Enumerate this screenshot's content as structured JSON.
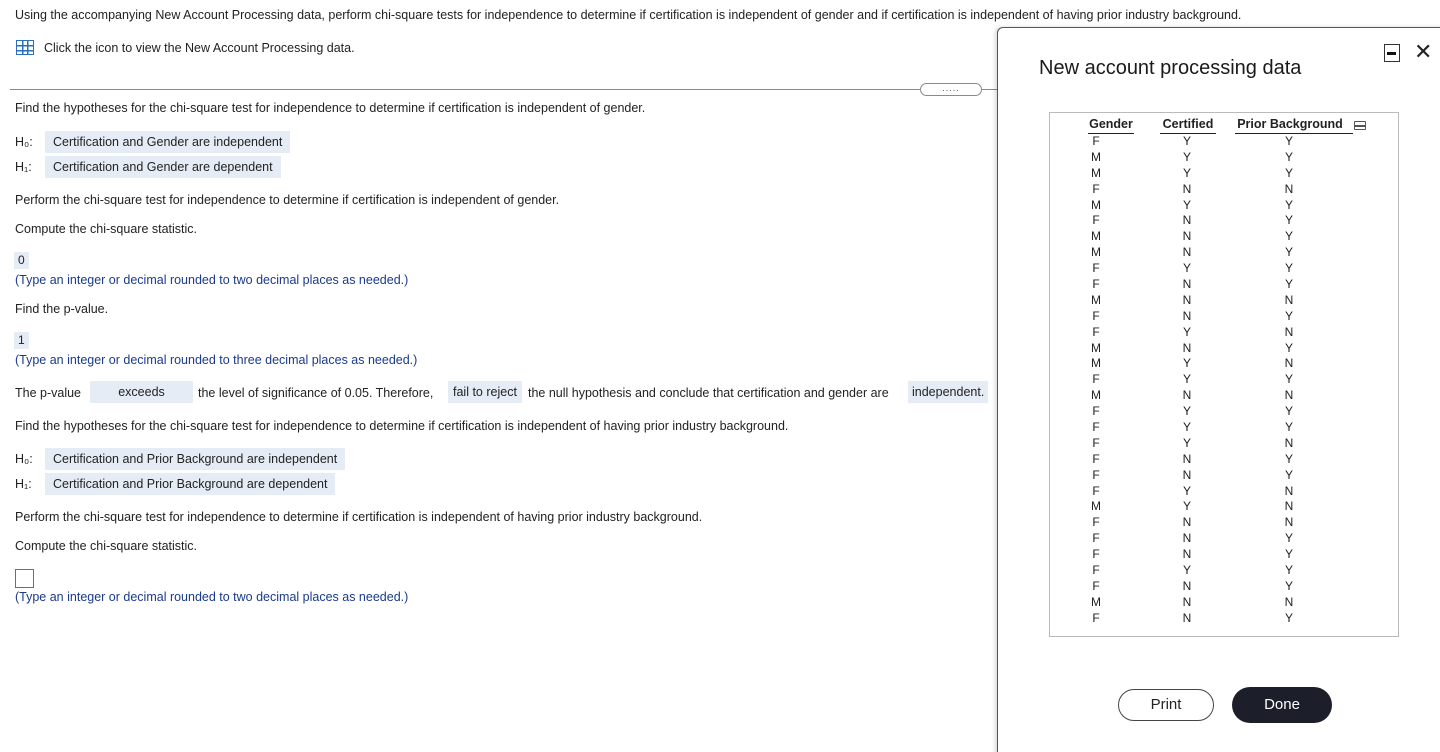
{
  "question": {
    "intro": "Using the accompanying New Account Processing data, perform chi-square tests for independence to determine if certification is independent of gender and if certification is independent of having prior industry background.",
    "data_link": "Click the icon to view the New Account Processing data.",
    "more_label": "....."
  },
  "part1": {
    "prompt": "Find the hypotheses for the chi-square test for independence to determine if certification is independent of gender.",
    "h0_label": "H₀:",
    "h0_answer": "Certification and Gender are independent",
    "h1_label": "H₁:",
    "h1_answer": "Certification and Gender are dependent",
    "perform": "Perform the chi-square test for independence to determine if certification is independent of gender.",
    "compute": "Compute the chi-square statistic.",
    "chi_value": "0",
    "chi_hint": "(Type an integer or decimal rounded to two decimal places as needed.)",
    "pvalue_prompt": "Find the p-value.",
    "pvalue": "1",
    "pvalue_hint": "(Type an integer or decimal rounded to three decimal places as needed.)",
    "conclusion_pre": "The p-value",
    "conclusion_choice1": "exceeds",
    "conclusion_mid": "the level of significance of 0.05. Therefore,",
    "conclusion_choice2": "fail to reject",
    "conclusion_post": "the null hypothesis and conclude that certification and gender are",
    "conclusion_choice3": "independent."
  },
  "part2": {
    "prompt": "Find the hypotheses for the chi-square test for independence to determine if certification is independent of having prior industry background.",
    "h0_label": "H₀:",
    "h0_answer": "Certification and Prior Background are independent",
    "h1_label": "H₁:",
    "h1_answer": "Certification and Prior Background are dependent",
    "perform": "Perform the chi-square test for independence to determine if certification is independent of having prior industry background.",
    "compute": "Compute the chi-square statistic.",
    "chi_value": "",
    "chi_hint": "(Type an integer or decimal rounded to two decimal places as needed.)"
  },
  "popup": {
    "title": "New account processing data",
    "headers": [
      "Gender",
      "Certified",
      "Prior Background"
    ],
    "gender": [
      "F",
      "M",
      "M",
      "F",
      "M",
      "F",
      "M",
      "M",
      "F",
      "F",
      "M",
      "F",
      "F",
      "M",
      "M",
      "F",
      "M",
      "F",
      "F",
      "F",
      "F",
      "F",
      "F",
      "M",
      "F",
      "F",
      "F",
      "F",
      "F",
      "M",
      "F"
    ],
    "certified": [
      "Y",
      "Y",
      "Y",
      "N",
      "Y",
      "N",
      "N",
      "N",
      "Y",
      "N",
      "N",
      "N",
      "Y",
      "N",
      "Y",
      "Y",
      "N",
      "Y",
      "Y",
      "Y",
      "N",
      "N",
      "Y",
      "Y",
      "N",
      "N",
      "N",
      "Y",
      "N",
      "N",
      "N"
    ],
    "prior": [
      "Y",
      "Y",
      "Y",
      "N",
      "Y",
      "Y",
      "Y",
      "Y",
      "Y",
      "Y",
      "N",
      "Y",
      "N",
      "Y",
      "N",
      "Y",
      "N",
      "Y",
      "Y",
      "N",
      "Y",
      "Y",
      "N",
      "N",
      "N",
      "Y",
      "Y",
      "Y",
      "Y",
      "N",
      "Y"
    ],
    "print_label": "Print",
    "done_label": "Done"
  },
  "icons": [
    "table-icon",
    "minimize-icon",
    "close-icon",
    "copy-icon"
  ],
  "colors": {
    "answer_bg": "#e6ecf5",
    "hint_text": "#1b3a8c",
    "done_bg": "#1c1f2a",
    "icon_blue": "#2a6fb8"
  }
}
